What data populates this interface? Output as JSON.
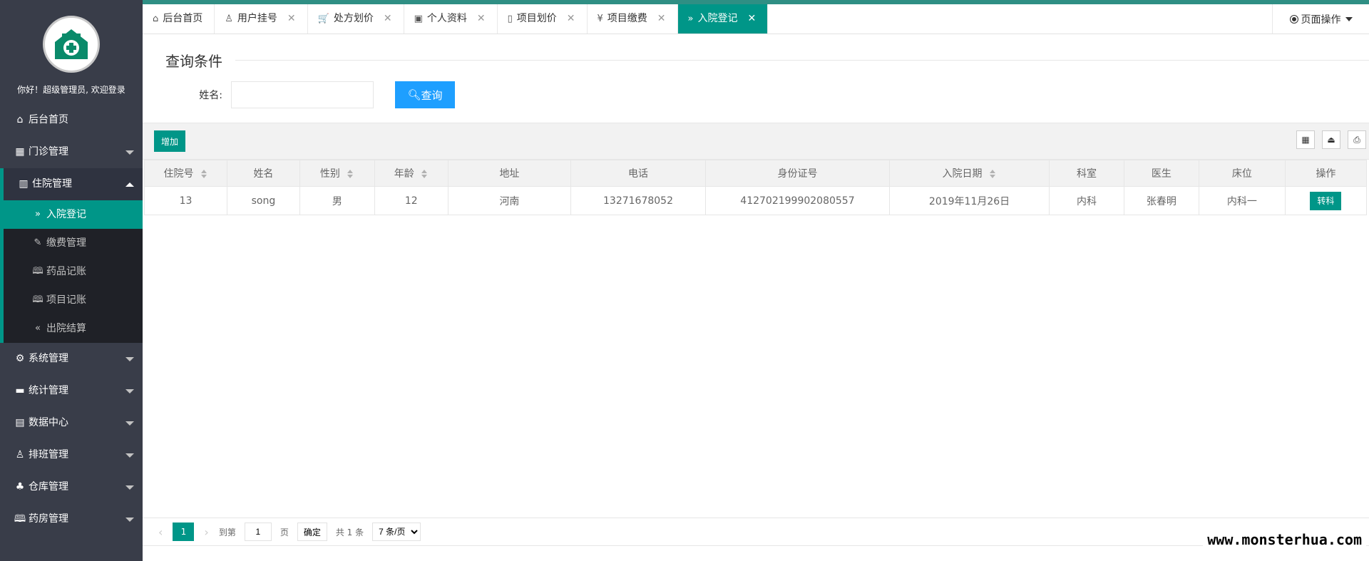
{
  "sidebar": {
    "welcome": "你好！超级管理员, 欢迎登录",
    "menu": [
      {
        "label": "后台首页",
        "icon": "⌂"
      },
      {
        "label": "门诊管理",
        "icon": "▦"
      },
      {
        "label": "住院管理",
        "icon": "▥"
      }
    ],
    "submenu": [
      {
        "label": "入院登记",
        "icon": "»"
      },
      {
        "label": "缴费管理",
        "icon": "✎"
      },
      {
        "label": "药品记账",
        "icon": "🕮"
      },
      {
        "label": "项目记账",
        "icon": "🕮"
      },
      {
        "label": "出院结算",
        "icon": "«"
      }
    ],
    "menu_after": [
      {
        "label": "系统管理",
        "icon": "⚙"
      },
      {
        "label": "统计管理",
        "icon": "▬"
      },
      {
        "label": "数据中心",
        "icon": "▤"
      },
      {
        "label": "排班管理",
        "icon": "♙"
      },
      {
        "label": "仓库管理",
        "icon": "♣"
      },
      {
        "label": "药房管理",
        "icon": "🕮"
      }
    ]
  },
  "tabs": [
    {
      "label": "后台首页",
      "icon": "⌂"
    },
    {
      "label": "用户挂号",
      "icon": "♙"
    },
    {
      "label": "处方划价",
      "icon": "🛒"
    },
    {
      "label": "个人资料",
      "icon": "▣"
    },
    {
      "label": "项目划价",
      "icon": "▯"
    },
    {
      "label": "项目缴费",
      "icon": "¥"
    },
    {
      "label": "入院登记",
      "icon": "»"
    }
  ],
  "page_ops": "页面操作",
  "query": {
    "legend": "查询条件",
    "name_label": "姓名:",
    "name_value": "",
    "button": "查询"
  },
  "toolbar": {
    "add": "增加",
    "icons": [
      "columns-icon",
      "export-icon",
      "print-icon"
    ]
  },
  "table": {
    "headers": [
      "住院号",
      "姓名",
      "性别",
      "年龄",
      "地址",
      "电话",
      "身份证号",
      "入院日期",
      "科室",
      "医生",
      "床位",
      "操作"
    ],
    "rows": [
      {
        "id": "13",
        "name": "song",
        "gender": "男",
        "age": "12",
        "address": "河南",
        "phone": "13271678052",
        "idcard": "412702199902080557",
        "date": "2019年11月26日",
        "dept": "内科",
        "doctor": "张春明",
        "bed": "内科一",
        "op": "转科"
      }
    ]
  },
  "pager": {
    "current": "1",
    "goto": "到第",
    "page_input": "1",
    "page_unit": "页",
    "confirm": "确定",
    "total": "共 1 条",
    "per_page": "7 条/页"
  },
  "watermark": "www.monsterhua.com",
  "colors": {
    "accent": "#009688",
    "query_button": "#1e9fff",
    "sidebar": "#393d49"
  }
}
